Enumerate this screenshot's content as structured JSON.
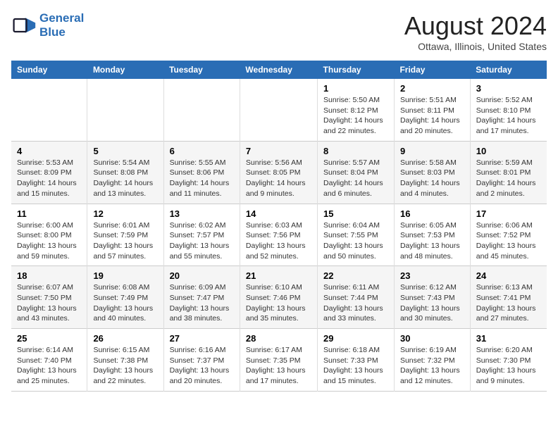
{
  "header": {
    "logo_line1": "General",
    "logo_line2": "Blue",
    "month_year": "August 2024",
    "location": "Ottawa, Illinois, United States"
  },
  "weekdays": [
    "Sunday",
    "Monday",
    "Tuesday",
    "Wednesday",
    "Thursday",
    "Friday",
    "Saturday"
  ],
  "weeks": [
    [
      {
        "day": "",
        "empty": true
      },
      {
        "day": "",
        "empty": true
      },
      {
        "day": "",
        "empty": true
      },
      {
        "day": "",
        "empty": true
      },
      {
        "day": "1",
        "sunrise": "5:50 AM",
        "sunset": "8:12 PM",
        "daylight": "14 hours and 22 minutes."
      },
      {
        "day": "2",
        "sunrise": "5:51 AM",
        "sunset": "8:11 PM",
        "daylight": "14 hours and 20 minutes."
      },
      {
        "day": "3",
        "sunrise": "5:52 AM",
        "sunset": "8:10 PM",
        "daylight": "14 hours and 17 minutes."
      }
    ],
    [
      {
        "day": "4",
        "sunrise": "5:53 AM",
        "sunset": "8:09 PM",
        "daylight": "14 hours and 15 minutes."
      },
      {
        "day": "5",
        "sunrise": "5:54 AM",
        "sunset": "8:08 PM",
        "daylight": "14 hours and 13 minutes."
      },
      {
        "day": "6",
        "sunrise": "5:55 AM",
        "sunset": "8:06 PM",
        "daylight": "14 hours and 11 minutes."
      },
      {
        "day": "7",
        "sunrise": "5:56 AM",
        "sunset": "8:05 PM",
        "daylight": "14 hours and 9 minutes."
      },
      {
        "day": "8",
        "sunrise": "5:57 AM",
        "sunset": "8:04 PM",
        "daylight": "14 hours and 6 minutes."
      },
      {
        "day": "9",
        "sunrise": "5:58 AM",
        "sunset": "8:03 PM",
        "daylight": "14 hours and 4 minutes."
      },
      {
        "day": "10",
        "sunrise": "5:59 AM",
        "sunset": "8:01 PM",
        "daylight": "14 hours and 2 minutes."
      }
    ],
    [
      {
        "day": "11",
        "sunrise": "6:00 AM",
        "sunset": "8:00 PM",
        "daylight": "13 hours and 59 minutes."
      },
      {
        "day": "12",
        "sunrise": "6:01 AM",
        "sunset": "7:59 PM",
        "daylight": "13 hours and 57 minutes."
      },
      {
        "day": "13",
        "sunrise": "6:02 AM",
        "sunset": "7:57 PM",
        "daylight": "13 hours and 55 minutes."
      },
      {
        "day": "14",
        "sunrise": "6:03 AM",
        "sunset": "7:56 PM",
        "daylight": "13 hours and 52 minutes."
      },
      {
        "day": "15",
        "sunrise": "6:04 AM",
        "sunset": "7:55 PM",
        "daylight": "13 hours and 50 minutes."
      },
      {
        "day": "16",
        "sunrise": "6:05 AM",
        "sunset": "7:53 PM",
        "daylight": "13 hours and 48 minutes."
      },
      {
        "day": "17",
        "sunrise": "6:06 AM",
        "sunset": "7:52 PM",
        "daylight": "13 hours and 45 minutes."
      }
    ],
    [
      {
        "day": "18",
        "sunrise": "6:07 AM",
        "sunset": "7:50 PM",
        "daylight": "13 hours and 43 minutes."
      },
      {
        "day": "19",
        "sunrise": "6:08 AM",
        "sunset": "7:49 PM",
        "daylight": "13 hours and 40 minutes."
      },
      {
        "day": "20",
        "sunrise": "6:09 AM",
        "sunset": "7:47 PM",
        "daylight": "13 hours and 38 minutes."
      },
      {
        "day": "21",
        "sunrise": "6:10 AM",
        "sunset": "7:46 PM",
        "daylight": "13 hours and 35 minutes."
      },
      {
        "day": "22",
        "sunrise": "6:11 AM",
        "sunset": "7:44 PM",
        "daylight": "13 hours and 33 minutes."
      },
      {
        "day": "23",
        "sunrise": "6:12 AM",
        "sunset": "7:43 PM",
        "daylight": "13 hours and 30 minutes."
      },
      {
        "day": "24",
        "sunrise": "6:13 AM",
        "sunset": "7:41 PM",
        "daylight": "13 hours and 27 minutes."
      }
    ],
    [
      {
        "day": "25",
        "sunrise": "6:14 AM",
        "sunset": "7:40 PM",
        "daylight": "13 hours and 25 minutes."
      },
      {
        "day": "26",
        "sunrise": "6:15 AM",
        "sunset": "7:38 PM",
        "daylight": "13 hours and 22 minutes."
      },
      {
        "day": "27",
        "sunrise": "6:16 AM",
        "sunset": "7:37 PM",
        "daylight": "13 hours and 20 minutes."
      },
      {
        "day": "28",
        "sunrise": "6:17 AM",
        "sunset": "7:35 PM",
        "daylight": "13 hours and 17 minutes."
      },
      {
        "day": "29",
        "sunrise": "6:18 AM",
        "sunset": "7:33 PM",
        "daylight": "13 hours and 15 minutes."
      },
      {
        "day": "30",
        "sunrise": "6:19 AM",
        "sunset": "7:32 PM",
        "daylight": "13 hours and 12 minutes."
      },
      {
        "day": "31",
        "sunrise": "6:20 AM",
        "sunset": "7:30 PM",
        "daylight": "13 hours and 9 minutes."
      }
    ]
  ]
}
